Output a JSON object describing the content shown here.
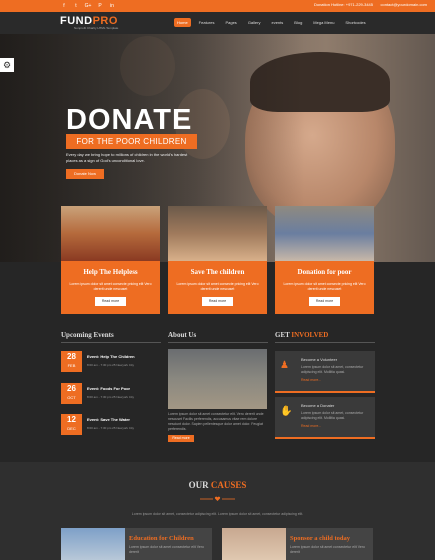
{
  "topbar": {
    "social": [
      "f",
      "t",
      "G+",
      "P",
      "in"
    ],
    "hotline": "Donation Hotline: +971-229-3445",
    "email": "contact@yourdomain.com"
  },
  "brand": {
    "name_a": "FUND",
    "name_b": "PRO",
    "tagline": "Nonprofit Charity HTML Template"
  },
  "nav": [
    "Home",
    "Features",
    "Pages",
    "Gallery",
    "events",
    "Blog",
    "Mega Menu",
    "Shortcodes"
  ],
  "hero": {
    "title": "DONATE",
    "subtitle": "FOR THE POOR CHILDREN",
    "desc": "Every day we bring hope to millions of children in the world's hardest places as a sign of God's unconditional love.",
    "button": "Donate Now"
  },
  "cards": [
    {
      "title": "Help The Helpless",
      "text": "Lorem ipsum dolor sit amet consecte pricing elit Vero dererit unde nescuset",
      "button": "Read more"
    },
    {
      "title": "Save The children",
      "text": "Lorem ipsum dolor sit amet consecte pricing elit Vero dererit unde nescuset",
      "button": "Read more"
    },
    {
      "title": "Donation for poor",
      "text": "Lorem ipsum dolor sit amet consecte pricing elit Vero dererit unde nescuset",
      "button": "Read more"
    }
  ],
  "events": {
    "heading": "Upcoming Events",
    "items": [
      {
        "day": "28",
        "month": "FEB",
        "title": "Event: Help The Children",
        "meta": "8:00 am - 7:30 pm   25 Newyork City"
      },
      {
        "day": "26",
        "month": "OCT",
        "title": "Event: Foods For Poor",
        "meta": "8:00 am - 7:30 pm   25 Newyork City"
      },
      {
        "day": "12",
        "month": "DEC",
        "title": "Event: Save The Water",
        "meta": "8:00 am - 7:30 pm   25 Newyork City"
      }
    ]
  },
  "about": {
    "heading": "About Us",
    "text": "Lorem ipsum dolor sit amet consectetur elit. Vero dererit unde nescuset Facilis perferendis, accusamus vitae rem dolore nesciunt dolor. Sapien pellentesque dolor amet dolor. Feugiat perferendis.",
    "button": "Read more"
  },
  "involved": {
    "heading_a": "GET",
    "heading_b": " INVOLVED",
    "items": [
      {
        "title": "Become a Volunteer",
        "text": "Lorem ipsum dolor sit amet, consectetur adipiscing elit. Mollitia quasi.",
        "link": "Read more..."
      },
      {
        "title": "Become a Donater",
        "text": "Lorem ipsum dolor sit amet, consectetur adipiscing elit. Mollitia quasi.",
        "link": "Read more..."
      }
    ]
  },
  "causes": {
    "heading_a": "OUR",
    "heading_b": " CAUSES",
    "sub": "Lorem ipsum dolor sit amet, consectetur adipiscing elit. Lorem ipsum dolor sit amet, consectetur adipiscing elit.",
    "items": [
      {
        "title": "Education for Children",
        "text": "Lorem ipsum dolor sit amet consectetur elit Vero dererit"
      },
      {
        "title": "Sponsor a child today",
        "text": "Lorem ipsum dolor sit amet consectetur elit Vero dererit"
      }
    ]
  }
}
